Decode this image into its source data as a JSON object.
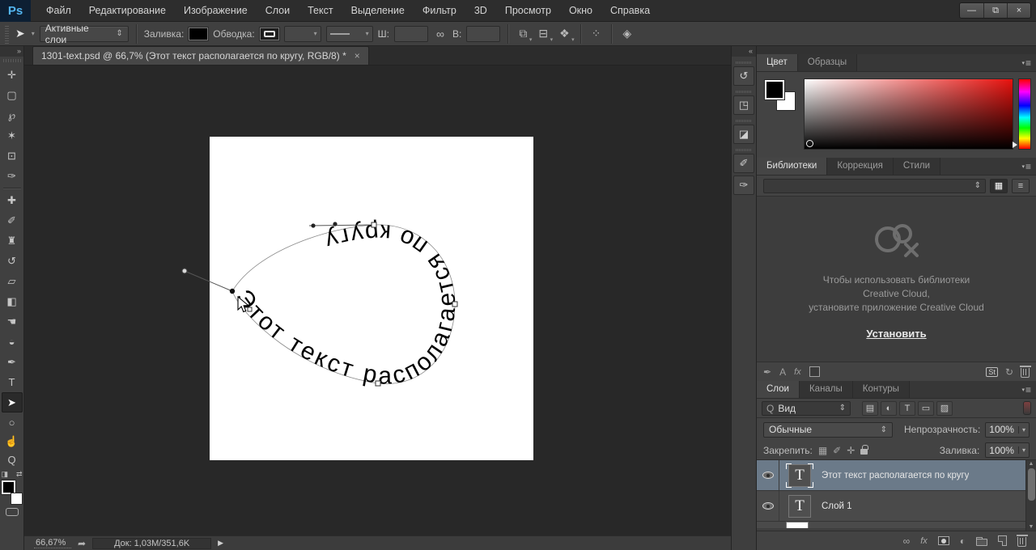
{
  "app": {
    "logo_text": "Ps"
  },
  "menu": {
    "items": [
      "Файл",
      "Редактирование",
      "Изображение",
      "Слои",
      "Текст",
      "Выделение",
      "Фильтр",
      "3D",
      "Просмотр",
      "Окно",
      "Справка"
    ]
  },
  "window_controls": {
    "minimize": "—",
    "restore": "⧉",
    "close": "×"
  },
  "options": {
    "preset_value": "Активные слои",
    "fill_label": "Заливка:",
    "stroke_label": "Обводка:",
    "width_label": "Ш:",
    "width_value": "",
    "height_label": "В:",
    "height_value": ""
  },
  "document_tab": {
    "title": "1301-text.psd @ 66,7% (Этот текст располагается по кругу, RGB/8) *",
    "close": "×"
  },
  "canvas": {
    "path_text": "Этот текст располагается по кругу"
  },
  "panels": {
    "color": {
      "tab_color": "Цвет",
      "tab_swatches": "Образцы"
    },
    "libraries": {
      "tab_libraries": "Библиотеки",
      "tab_adjustments": "Коррекция",
      "tab_styles": "Стили",
      "message_line1": "Чтобы использовать библиотеки",
      "message_line2": "Creative Cloud,",
      "message_line3": "установите приложение Creative Cloud",
      "install_link": "Установить",
      "stock_badge": "St",
      "char_style": "A",
      "fx": "fx"
    },
    "layers": {
      "tab_layers": "Слои",
      "tab_channels": "Каналы",
      "tab_paths": "Контуры",
      "filter_value": "Вид",
      "blend_value": "Обычные",
      "opacity_label": "Непрозрачность:",
      "opacity_value": "100%",
      "lock_label": "Закрепить:",
      "fill_label": "Заливка:",
      "fill_value": "100%",
      "rows": [
        {
          "name": "Этот текст располагается по кругу",
          "thumb": "T"
        },
        {
          "name": "Слой 1",
          "thumb": "T"
        }
      ],
      "fx_label": "fx"
    }
  },
  "status": {
    "zoom": "66,67%",
    "doc_info": "Док: 1,03M/351,6K"
  },
  "icons": {
    "expand": "»",
    "collapse": "«",
    "dropdown": "▾",
    "stepper": "⇕",
    "panel_menu": "≡",
    "move": "✛",
    "marquee": "▢",
    "lasso": "℘",
    "magic_wand": "✶",
    "crop": "⊡",
    "eyedropper": "✑",
    "healing": "✚",
    "brush": "✐",
    "clone_stamp": "♜",
    "history_brush": "↺",
    "eraser": "▱",
    "gradient": "◧",
    "smudge": "☚",
    "dodge": "◒",
    "pen": "✒",
    "type": "T",
    "path_select": "➤",
    "ellipse": "○",
    "hand": "☝",
    "zoom": "Q",
    "swap_colors": "⇄",
    "default_colors": "◨",
    "align_left": "⧉",
    "align_center": "⊟",
    "arrange": "❖",
    "distribute": "⁘",
    "constrain": "◈",
    "link": "∞",
    "search": "Q",
    "filter_image": "▤",
    "filter_adjust": "◐",
    "filter_type": "T",
    "filter_vector": "▭",
    "filter_smart": "▨",
    "lock_checker": "▦",
    "lock_brush": "✐",
    "lock_move": "✛",
    "adjustment": "◐",
    "share": "➦",
    "play_arrow": "▶",
    "dock_history": "↺",
    "dock_properties": "◳",
    "dock_clip": "◪",
    "dock_brushes": "✐",
    "dock_brush2": "✑",
    "grid_view": "▦",
    "list_view": "≡",
    "add_graphic": "✒",
    "sync_off": "↻",
    "scroll_up": "▲",
    "scroll_down": "▼"
  },
  "colors": {
    "accent_blue": "#53b5f0",
    "selected_layer": "#6b7a89",
    "canvas_text": "#000000"
  }
}
